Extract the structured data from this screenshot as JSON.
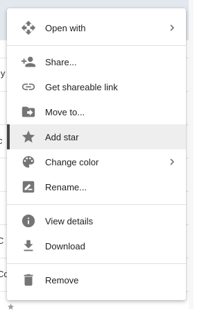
{
  "background": {
    "fragments": [
      "ly",
      "c",
      "C",
      "Co"
    ]
  },
  "menu": {
    "open_with": "Open with",
    "share": "Share...",
    "get_link": "Get shareable link",
    "move_to": "Move to...",
    "add_star": "Add star",
    "change_color": "Change color",
    "rename": "Rename...",
    "view_details": "View details",
    "download": "Download",
    "remove": "Remove"
  },
  "colors": {
    "icon": "#757575",
    "active_row": "#eeeeee",
    "active_bar": "#444746"
  }
}
